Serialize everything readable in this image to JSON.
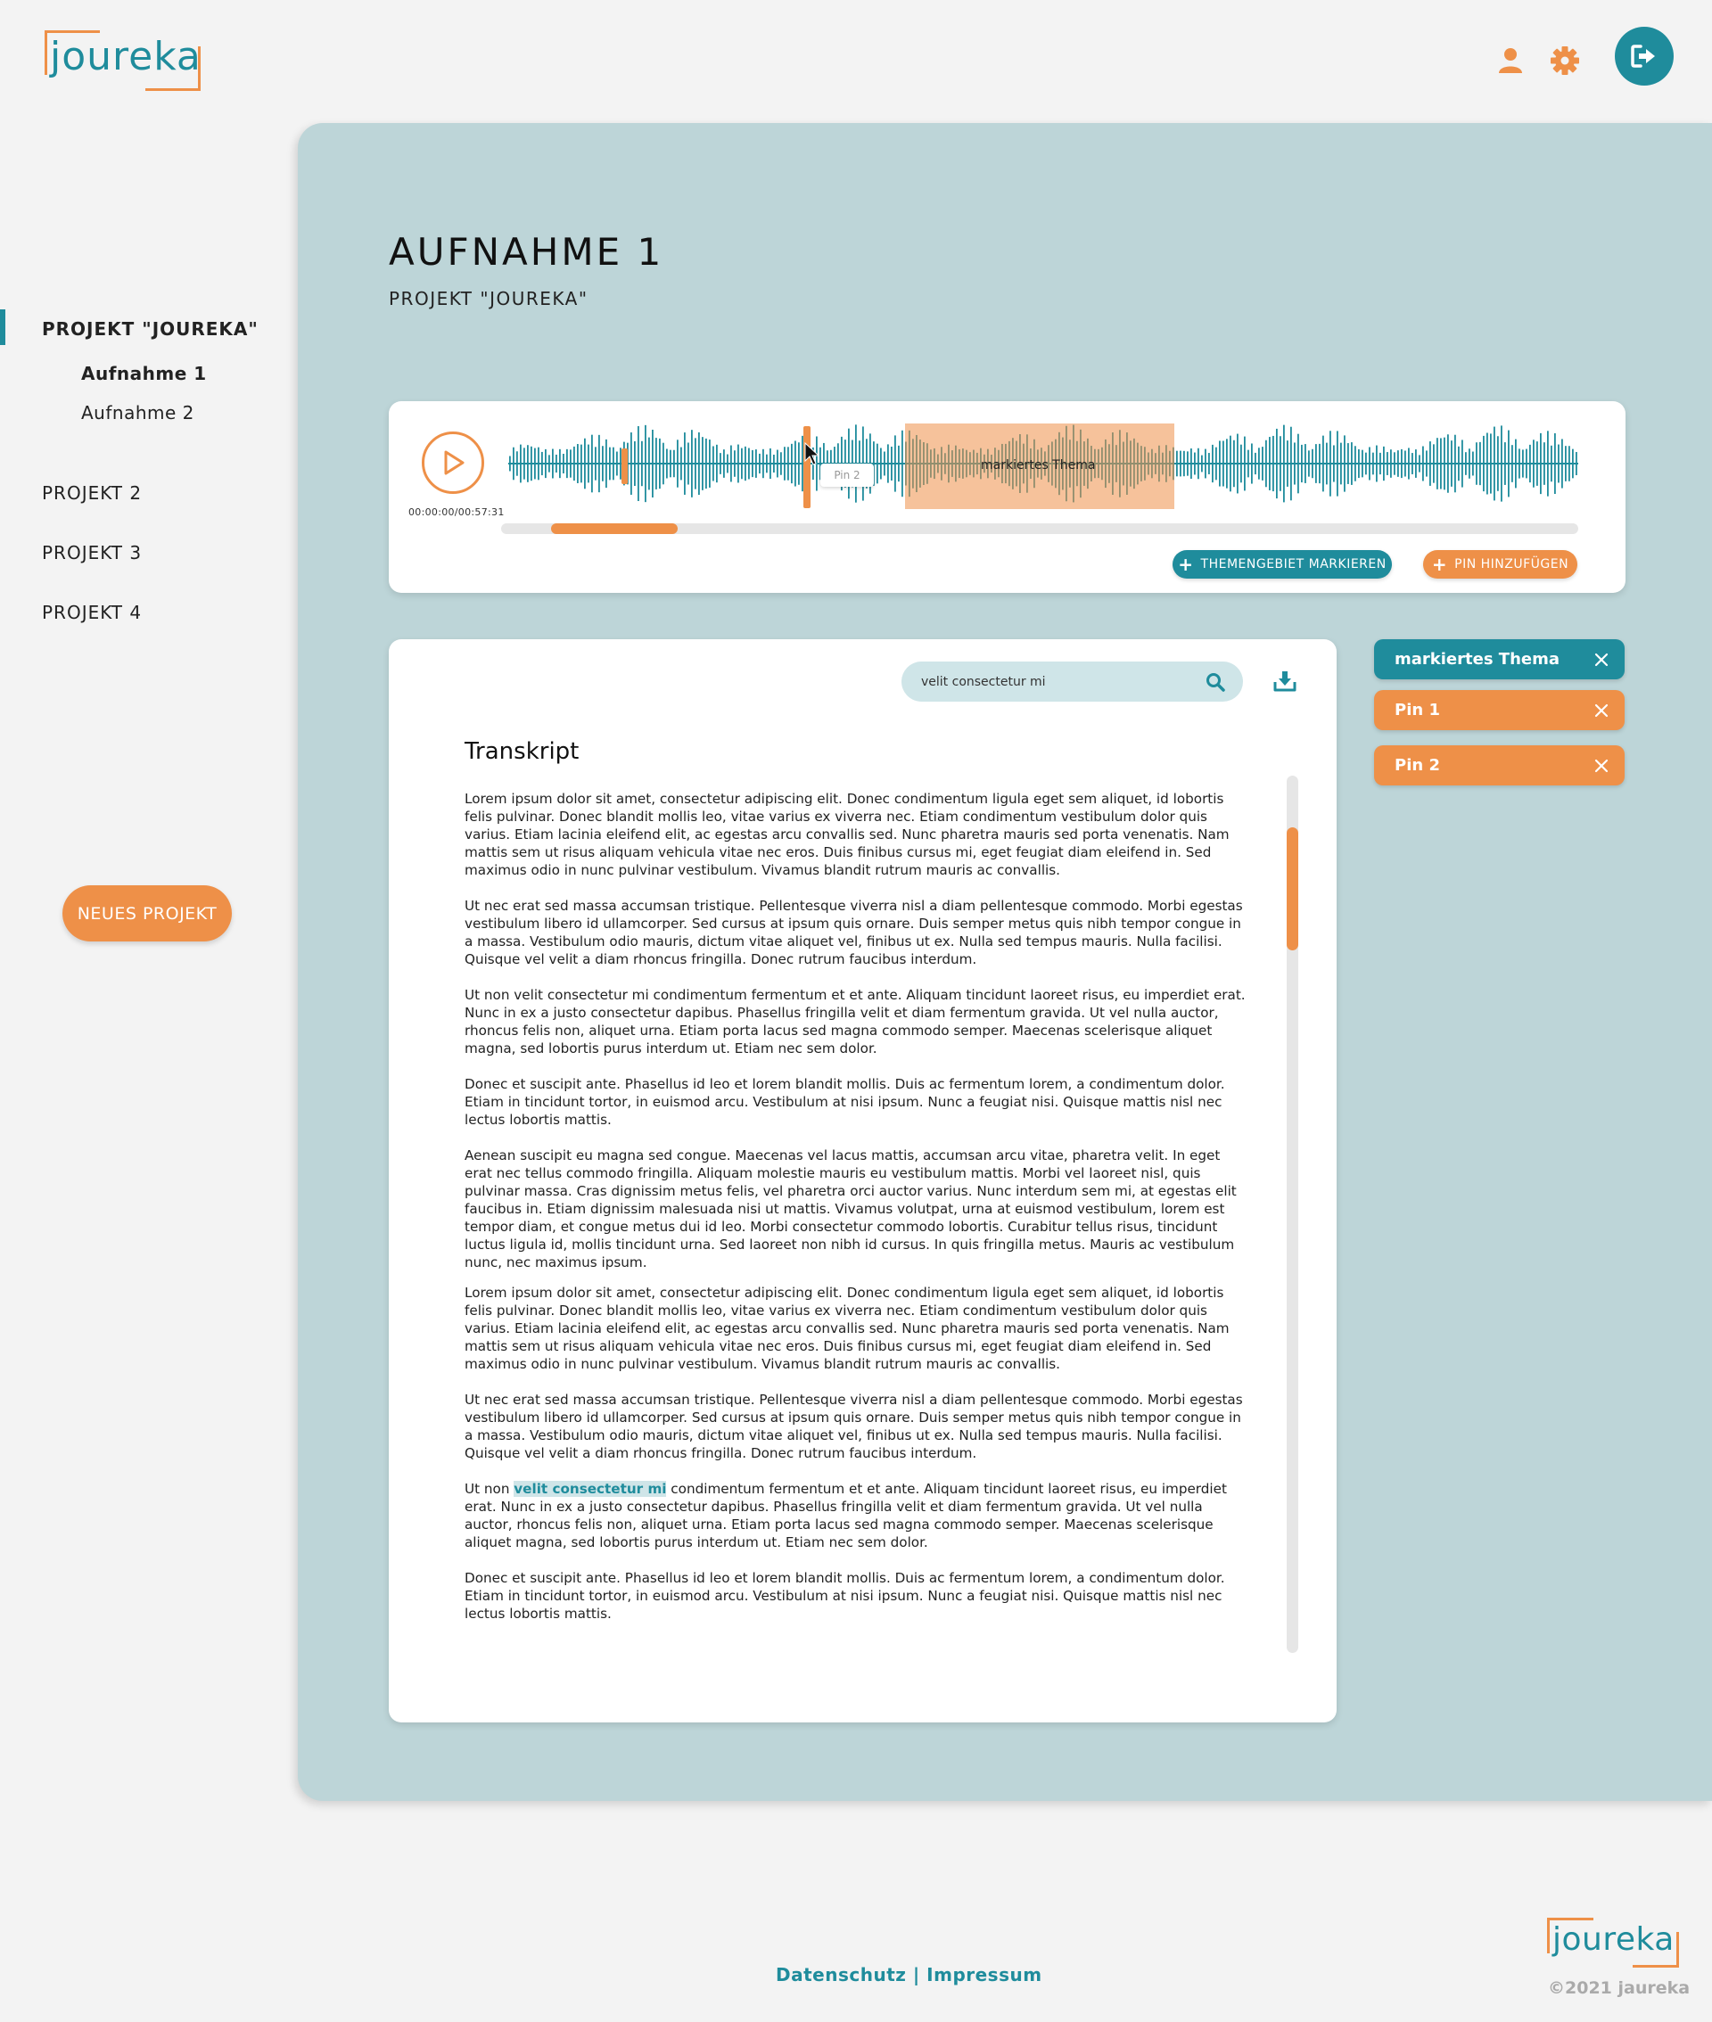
{
  "brand": {
    "logo_text": "joureka"
  },
  "colors": {
    "teal": "#1f8c9c",
    "orange": "#ee9048",
    "panel": "#bdd5d8"
  },
  "header": {
    "icons": [
      "user-icon",
      "gear-icon",
      "logout-icon"
    ]
  },
  "sidebar": {
    "projects": [
      {
        "label": "PROJEKT \"JOUREKA\"",
        "active": true,
        "recordings": [
          {
            "label": "Aufnahme 1",
            "active": true
          },
          {
            "label": "Aufnahme 2",
            "active": false
          }
        ]
      },
      {
        "label": "PROJEKT 2",
        "active": false
      },
      {
        "label": "PROJEKT 3",
        "active": false
      },
      {
        "label": "PROJEKT 4",
        "active": false
      }
    ],
    "new_project_label": "NEUES PROJEKT"
  },
  "page": {
    "title": "AUFNAHME 1",
    "subtitle": "PROJEKT \"JOUREKA\""
  },
  "player": {
    "time": "00:00:00/00:57:31",
    "theme_region_label": "markiertes Thema",
    "pin_tooltip": "Pin 2",
    "mark_topic_label": "THEMENGEBIET MARKIEREN",
    "add_pin_label": "PIN HINZUFÜGEN"
  },
  "search": {
    "value": "velit consectetur mi"
  },
  "transcript": {
    "heading": "Transkript",
    "highlight": "velit consectetur mi",
    "paragraphs": [
      "Lorem ipsum dolor sit amet, consectetur adipiscing elit. Donec condimentum ligula eget sem aliquet, id lobortis felis pulvinar. Donec blandit mollis leo, vitae varius ex viverra nec. Etiam condimentum vestibulum dolor quis varius. Etiam lacinia eleifend elit, ac egestas arcu convallis sed. Nunc pharetra mauris sed porta venenatis. Nam mattis sem ut risus aliquam vehicula vitae nec eros. Duis finibus cursus mi, eget feugiat diam eleifend in. Sed maximus odio in nunc pulvinar vestibulum. Vivamus blandit rutrum mauris ac convallis.",
      "Ut nec erat sed massa accumsan tristique. Pellentesque viverra nisl a diam pellentesque commodo. Morbi egestas vestibulum libero id ullamcorper. Sed cursus at ipsum quis ornare. Duis semper metus quis nibh tempor congue in a massa. Vestibulum odio mauris, dictum vitae aliquet vel, finibus ut ex. Nulla sed tempus mauris. Nulla facilisi. Quisque vel velit a diam rhoncus fringilla. Donec rutrum faucibus interdum.",
      "Ut non velit consectetur mi condimentum fermentum et et ante. Aliquam tincidunt laoreet risus, eu imperdiet erat. Nunc in ex a justo consectetur dapibus. Phasellus fringilla velit et diam fermentum gravida. Ut vel nulla auctor, rhoncus felis non, aliquet urna. Etiam porta lacus sed magna commodo semper. Maecenas scelerisque aliquet magna, sed lobortis purus interdum ut. Etiam nec sem dolor.",
      "Donec et suscipit ante. Phasellus id leo et lorem blandit mollis. Duis ac fermentum lorem, a condimentum dolor. Etiam in tincidunt tortor, in euismod arcu. Vestibulum at nisi ipsum. Nunc a feugiat nisi. Quisque mattis nisl nec lectus lobortis mattis.",
      "Aenean suscipit eu magna sed congue. Maecenas vel lacus mattis, accumsan arcu vitae, pharetra velit. In eget erat nec tellus commodo fringilla. Aliquam molestie mauris eu vestibulum mattis. Morbi vel laoreet nisl, quis pulvinar massa. Cras dignissim metus felis, vel pharetra orci auctor varius. Nunc interdum sem mi, at egestas elit faucibus in. Etiam dignissim malesuada nisi ut mattis. Vivamus volutpat, urna at euismod vestibulum, lorem est tempor diam, et congue metus dui id leo. Morbi consectetur commodo lobortis. Curabitur tellus risus, tincidunt luctus ligula id, mollis tincidunt urna. Sed laoreet non nibh id cursus. In quis fringilla metus. Mauris ac vestibulum nunc, nec maximus ipsum.",
      "Lorem ipsum dolor sit amet, consectetur adipiscing elit. Donec condimentum ligula eget sem aliquet, id lobortis felis pulvinar. Donec blandit mollis leo, vitae varius ex viverra nec. Etiam condimentum vestibulum dolor quis varius. Etiam lacinia eleifend elit, ac egestas arcu convallis sed. Nunc pharetra mauris sed porta venenatis. Nam mattis sem ut risus aliquam vehicula vitae nec eros. Duis finibus cursus mi, eget feugiat diam eleifend in. Sed maximus odio in nunc pulvinar vestibulum. Vivamus blandit rutrum mauris ac convallis.",
      "Ut nec erat sed massa accumsan tristique. Pellentesque viverra nisl a diam pellentesque commodo. Morbi egestas vestibulum libero id ullamcorper. Sed cursus at ipsum quis ornare. Duis semper metus quis nibh tempor congue in a massa. Vestibulum odio mauris, dictum vitae aliquet vel, finibus ut ex. Nulla sed tempus mauris. Nulla facilisi. Quisque vel velit a diam rhoncus fringilla. Donec rutrum faucibus interdum.",
      {
        "before": "Ut non ",
        "highlight": "velit consectetur mi",
        "after": " condimentum fermentum et et ante. Aliquam tincidunt laoreet risus, eu imperdiet erat. Nunc in ex a justo consectetur dapibus. Phasellus fringilla velit et diam fermentum gravida. Ut vel nulla auctor, rhoncus felis non, aliquet urna. Etiam porta lacus sed magna commodo semper. Maecenas scelerisque aliquet magna, sed lobortis purus interdum ut. Etiam nec sem dolor."
      },
      "Donec et suscipit ante. Phasellus id leo et lorem blandit mollis. Duis ac fermentum lorem, a condimentum dolor. Etiam in tincidunt tortor, in euismod arcu. Vestibulum at nisi ipsum. Nunc a feugiat nisi. Quisque mattis nisl nec lectus lobortis mattis."
    ]
  },
  "tags": [
    {
      "label": "markiertes Thema",
      "kind": "theme"
    },
    {
      "label": "Pin 1",
      "kind": "pin"
    },
    {
      "label": "Pin 2",
      "kind": "pin"
    }
  ],
  "footer": {
    "privacy": "Datenschutz",
    "separator": "|",
    "imprint": "Impressum",
    "logo_text": "joureka",
    "copyright": "©2021 jaureka"
  }
}
